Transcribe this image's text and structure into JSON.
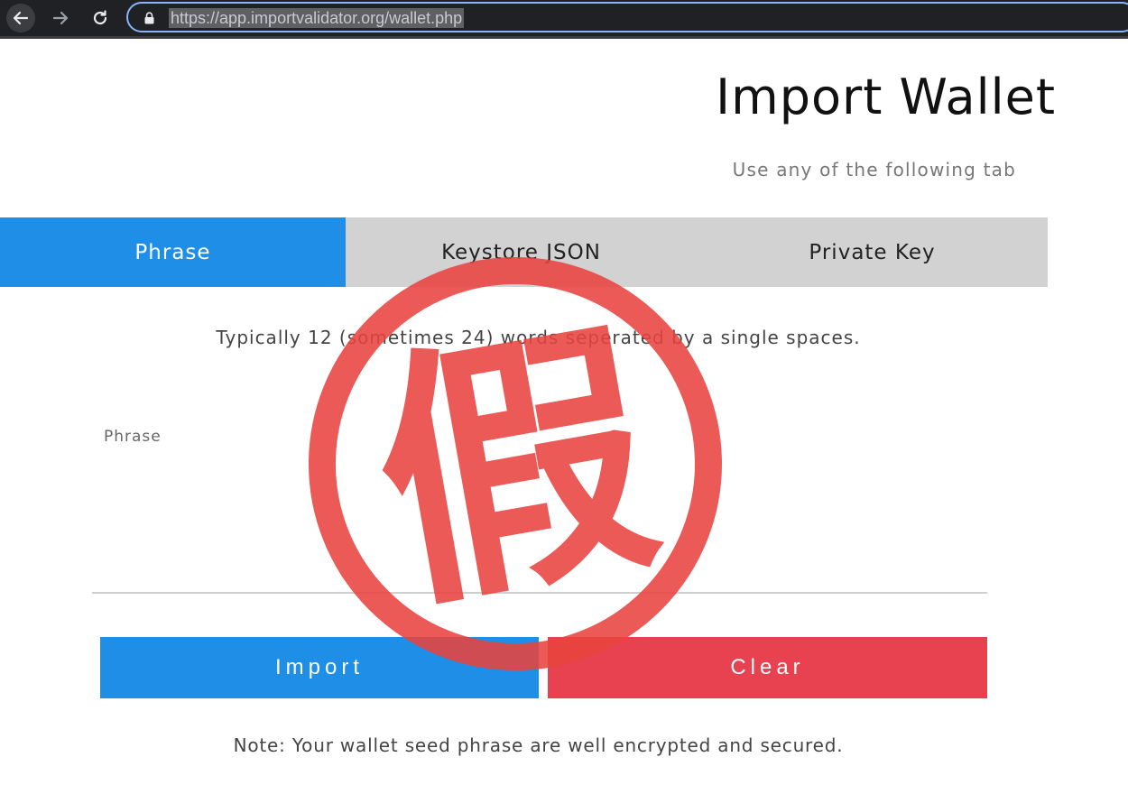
{
  "browser": {
    "url": "https://app.importvalidator.org/wallet.php"
  },
  "page": {
    "title": "Import Wallet",
    "subtitle": "Use any of the following tab"
  },
  "tabs": [
    {
      "label": "Phrase",
      "active": true
    },
    {
      "label": "Keystore JSON",
      "active": false
    },
    {
      "label": "Private Key",
      "active": false
    }
  ],
  "form": {
    "hint": "Typically 12 (sometimes 24) words seperated by a single spaces.",
    "phrase_label": "Phrase",
    "phrase_value": "",
    "import_label": "Import",
    "clear_label": "Clear",
    "note": "Note: Your wallet seed phrase are well encrypted and secured."
  },
  "stamp": {
    "text": "假",
    "color": "#e8433f"
  },
  "colors": {
    "primary": "#1e8ee6",
    "danger": "#e8414f",
    "tab_inactive": "#d2d2d2"
  }
}
